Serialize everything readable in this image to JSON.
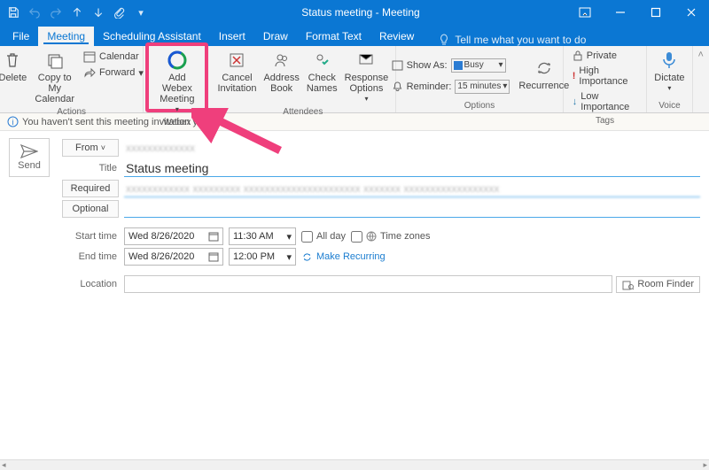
{
  "titlebar": {
    "title": "Status meeting  -  Meeting"
  },
  "tabs": {
    "file": "File",
    "meeting": "Meeting",
    "scheduling": "Scheduling Assistant",
    "insert": "Insert",
    "draw": "Draw",
    "format": "Format Text",
    "review": "Review",
    "tellme": "Tell me what you want to do"
  },
  "ribbon": {
    "actions": {
      "label": "Actions",
      "delete": "Delete",
      "copy": "Copy to My\nCalendar",
      "calendar": "Calendar",
      "forward": "Forward"
    },
    "webex": {
      "label": "Webex",
      "add": "Add Webex\nMeeting"
    },
    "attendees": {
      "label": "Attendees",
      "cancel": "Cancel\nInvitation",
      "address": "Address\nBook",
      "check": "Check\nNames",
      "response": "Response\nOptions"
    },
    "options": {
      "label": "Options",
      "showas_lbl": "Show As:",
      "showas_val": "Busy",
      "reminder_lbl": "Reminder:",
      "reminder_val": "15 minutes",
      "recurrence": "Recurrence"
    },
    "tags": {
      "label": "Tags",
      "private": "Private",
      "high": "High Importance",
      "low": "Low Importance"
    },
    "voice": {
      "label": "Voice",
      "dictate": "Dictate"
    }
  },
  "infobar": {
    "msg": "You haven't sent this meeting invitation yet."
  },
  "form": {
    "send": "Send",
    "from_lbl": "From",
    "from_val": "xxxxxxxxxxxxx",
    "title_lbl": "Title",
    "title_val": "Status meeting",
    "required_lbl": "Required",
    "required_val": "xxxxxxxxxxxx  xxxxxxxxx   xxxxxxxxxxxxxxxxxxxxxx   xxxxxxx   xxxxxxxxxxxxxxxxxx",
    "optional_lbl": "Optional",
    "start_lbl": "Start time",
    "end_lbl": "End time",
    "start_date": "Wed 8/26/2020",
    "start_time": "11:30 AM",
    "end_date": "Wed 8/26/2020",
    "end_time": "12:00 PM",
    "allday": "All day",
    "timezones": "Time zones",
    "make_recurring": "Make Recurring",
    "location_lbl": "Location",
    "roomfinder": "Room Finder"
  }
}
